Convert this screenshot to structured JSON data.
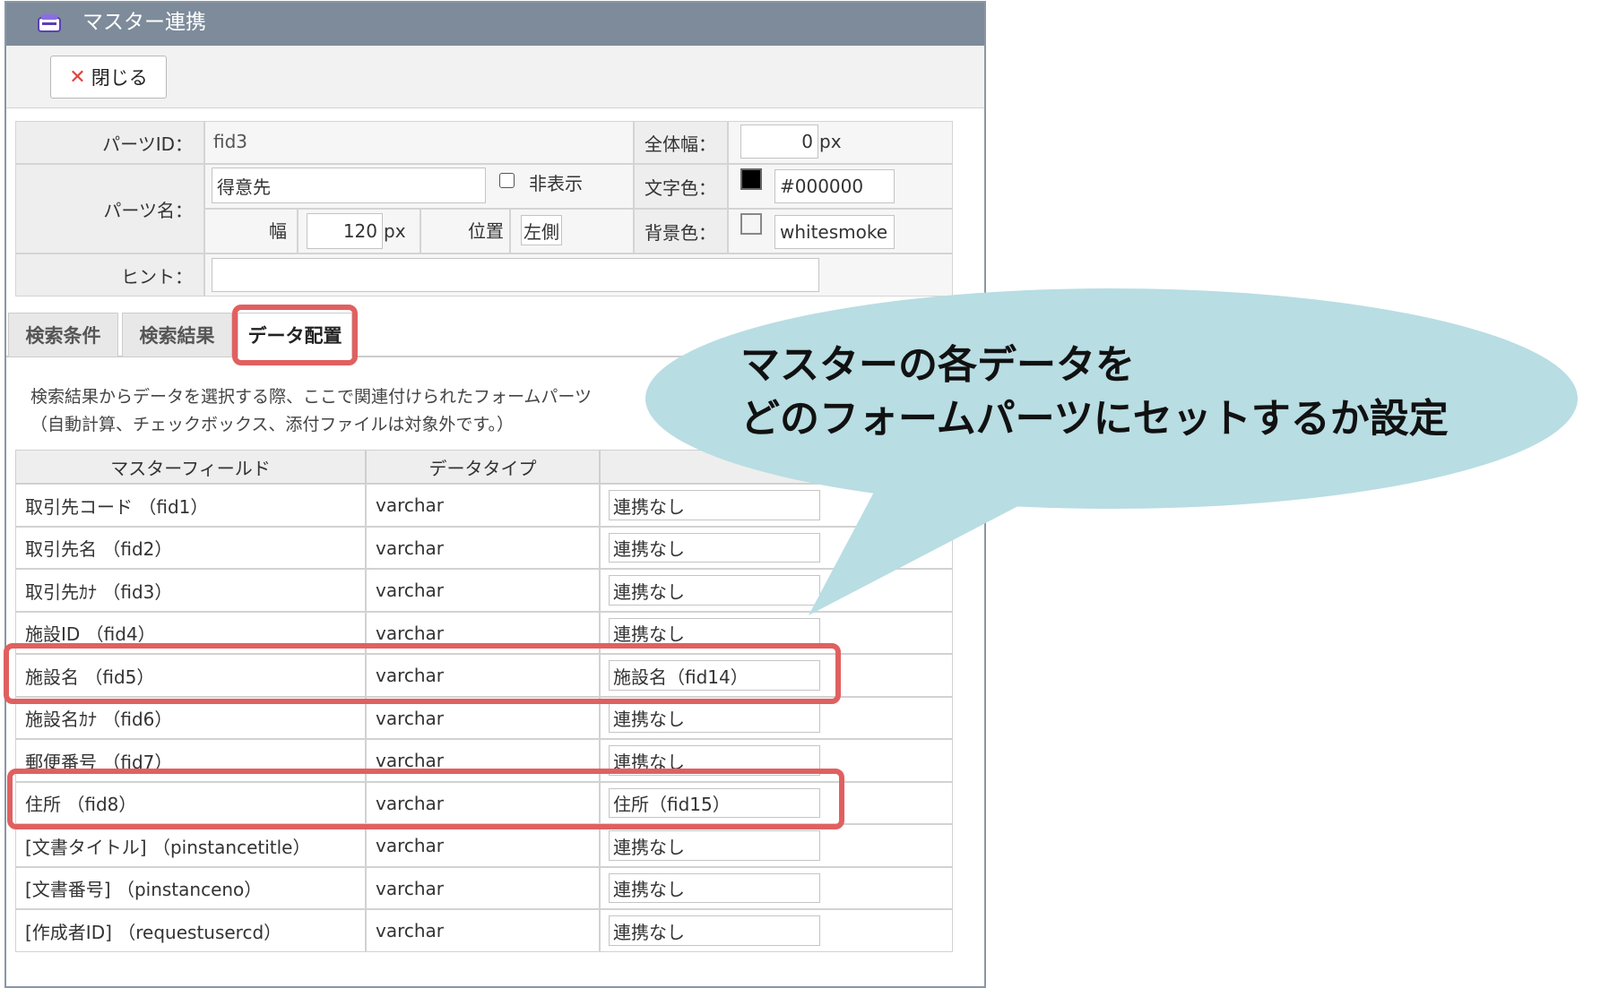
{
  "window": {
    "title": "マスター連携",
    "close_label": "閉じる"
  },
  "props": {
    "parts_id_label": "パーツID：",
    "parts_id_value": "fid3",
    "total_width_label": "全体幅：",
    "total_width_value": "0",
    "unit_px": "px",
    "parts_name_label": "パーツ名：",
    "parts_name_value": "得意先",
    "hide_label": "非表示",
    "text_color_label": "文字色：",
    "text_color_value": "#000000",
    "width_label": "幅",
    "width_value": "120",
    "position_label": "位置",
    "position_value": "左側",
    "bg_color_label": "背景色：",
    "bg_color_value": "whitesmoke",
    "hint_label": "ヒント：",
    "hint_value": ""
  },
  "tabs": [
    "検索条件",
    "検索結果",
    "データ配置"
  ],
  "active_tab": "データ配置",
  "description": {
    "line1": "検索結果からデータを選択する際、ここで関連付けられたフォームパーツ",
    "line2": "（自動計算、チェックボックス、添付ファイルは対象外です。）"
  },
  "table": {
    "headers": [
      "マスターフィールド",
      "データタイプ",
      ""
    ],
    "rows": [
      {
        "field": "取引先コード （fid1）",
        "type": "varchar",
        "link": "連携なし"
      },
      {
        "field": "取引先名 （fid2）",
        "type": "varchar",
        "link": "連携なし"
      },
      {
        "field": "取引先ｶﾅ （fid3）",
        "type": "varchar",
        "link": "連携なし"
      },
      {
        "field": "施設ID （fid4）",
        "type": "varchar",
        "link": "連携なし"
      },
      {
        "field": "施設名 （fid5）",
        "type": "varchar",
        "link": "施設名（fid14）"
      },
      {
        "field": "施設名ｶﾅ （fid6）",
        "type": "varchar",
        "link": "連携なし"
      },
      {
        "field": "郵便番号 （fid7）",
        "type": "varchar",
        "link": "連携なし"
      },
      {
        "field": "住所 （fid8）",
        "type": "varchar",
        "link": "住所（fid15）"
      },
      {
        "field": "[文書タイトル] （pinstancetitle）",
        "type": "varchar",
        "link": "連携なし"
      },
      {
        "field": "[文書番号] （pinstanceno）",
        "type": "varchar",
        "link": "連携なし"
      },
      {
        "field": "[作成者ID] （requestusercd）",
        "type": "varchar",
        "link": "連携なし"
      }
    ]
  },
  "callout": {
    "line1": "マスターの各データを",
    "line2": "どのフォームパーツにセットするか設定"
  },
  "colors": {
    "titlebar": "#7d8b9a",
    "highlight": "#e06060",
    "callout": "#b8dde3",
    "close_icon": "#e0423a"
  }
}
